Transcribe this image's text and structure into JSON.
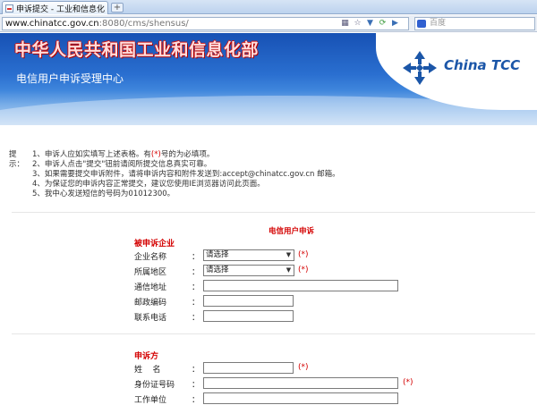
{
  "browser": {
    "tab_title": "申诉提交 - 工业和信息化",
    "new_tab_label": "+",
    "url_host": "www.chinatcc.gov.cn",
    "url_path": ":8080/cms/shensus/",
    "search_placeholder": "百度"
  },
  "banner": {
    "title": "中华人民共和国工业和信息化部",
    "subtitle": "电信用户申诉受理中心",
    "logo_text": "China TCC",
    "colors": {
      "title_red": "#c81010",
      "banner_blue": "#1751b4",
      "logo_blue": "#1b56a8"
    }
  },
  "notes": {
    "heading": "提示：",
    "items": [
      {
        "pre": "1、申诉人应如实填写上述表格。有",
        "mark": "(*)",
        "post": "号的为必填项。"
      },
      {
        "pre": "2、申诉人点击\"提交\"钮前请阅所提交信息真实可靠。",
        "mark": "",
        "post": ""
      },
      {
        "pre": "3、如果需要提交申诉附件，请将申诉内容和附件发送到:accept@chinatcc.gov.cn 邮箱。",
        "mark": "",
        "post": ""
      },
      {
        "pre": "4、为保证您的申诉内容正常提交，建议您使用IE浏览器访问此页面。",
        "mark": "",
        "post": ""
      },
      {
        "pre": "5、我中心发送短信的号码为01012300。",
        "mark": "",
        "post": ""
      }
    ]
  },
  "form": {
    "title": "电信用户申诉",
    "required_mark": "(*)",
    "respondent_section": {
      "title": "被申诉企业",
      "company_label": "企业名称",
      "company_value": "请选择",
      "region_label": "所属地区",
      "region_value": "请选择",
      "address_label": "通信地址",
      "postcode_label": "邮政编码",
      "phone_label": "联系电话"
    },
    "complainant_section": {
      "title": "申诉方",
      "name_label": "姓    名",
      "id_label": "身份证号码",
      "work_label": "工作单位"
    },
    "colon": "："
  }
}
